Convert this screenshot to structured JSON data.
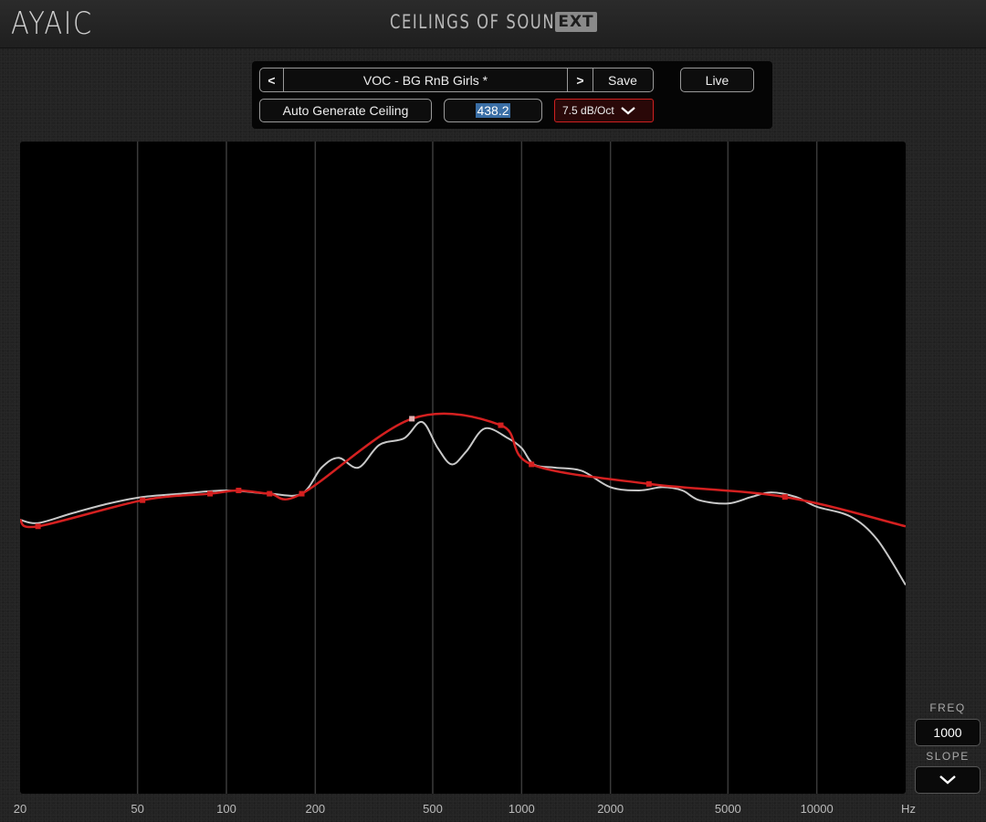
{
  "header": {
    "brand": "AYAIC",
    "product": "CEILINGS OF SOUND",
    "badge": "EXT"
  },
  "controls": {
    "prev_label": "<",
    "preset_name": "VOC - BG RnB Girls *",
    "next_label": ">",
    "save_label": "Save",
    "live_label": "Live",
    "auto_generate_label": "Auto Generate Ceiling",
    "value_field": "438.2",
    "slope_option": "7.5 dB/Oct"
  },
  "side": {
    "freq_label": "FREQ",
    "freq_value": "1000",
    "slope_label": "SLOPE"
  },
  "axis": {
    "unit": "Hz",
    "ticks": [
      "20",
      "50",
      "100",
      "200",
      "500",
      "1000",
      "2000",
      "5000",
      "10000"
    ]
  },
  "colors": {
    "ceiling_curve": "#d42020",
    "spectrum_curve": "#c8c8c8",
    "grid": "#3a3a3a",
    "accent_red": "#d02020"
  },
  "chart_data": {
    "type": "line",
    "x_scale": "log",
    "x_range": [
      20,
      20000
    ],
    "grid": true,
    "series": [
      {
        "role": "ceiling",
        "x": [
          20,
          23,
          52,
          88,
          110,
          140,
          180,
          425,
          850,
          1080,
          2700,
          7800,
          20000
        ],
        "y": [
          0.42,
          0.41,
          0.45,
          0.46,
          0.465,
          0.46,
          0.46,
          0.575,
          0.565,
          0.505,
          0.475,
          0.455,
          0.41
        ],
        "handles_x": [
          23,
          52,
          88,
          110,
          140,
          180,
          425,
          850,
          1080,
          2700,
          7800
        ]
      },
      {
        "role": "spectrum",
        "x": [
          20,
          23,
          30,
          40,
          52,
          70,
          100,
          140,
          180,
          210,
          240,
          280,
          330,
          400,
          460,
          520,
          580,
          650,
          750,
          900,
          1000,
          1100,
          1300,
          1600,
          2000,
          2500,
          3000,
          3500,
          4000,
          5000,
          6000,
          7000,
          8500,
          10000,
          13000,
          16000,
          20000
        ],
        "y": [
          0.42,
          0.415,
          0.43,
          0.445,
          0.455,
          0.46,
          0.465,
          0.46,
          0.46,
          0.5,
          0.515,
          0.5,
          0.535,
          0.545,
          0.57,
          0.53,
          0.505,
          0.525,
          0.56,
          0.545,
          0.53,
          0.505,
          0.5,
          0.495,
          0.47,
          0.465,
          0.47,
          0.465,
          0.45,
          0.445,
          0.455,
          0.462,
          0.455,
          0.44,
          0.425,
          0.39,
          0.32
        ]
      }
    ]
  }
}
